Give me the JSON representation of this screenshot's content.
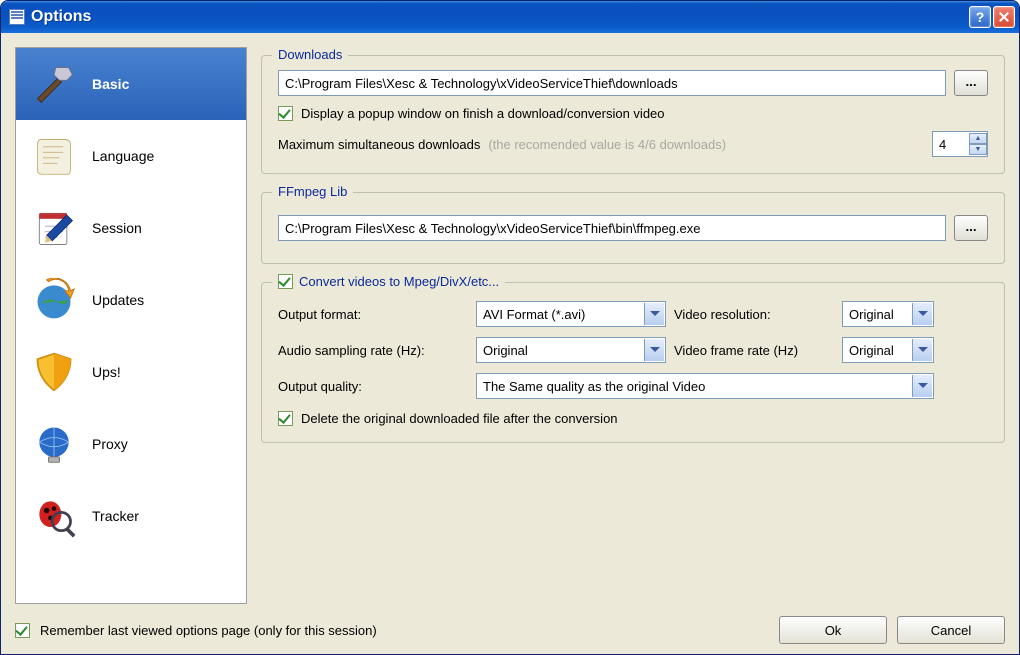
{
  "window": {
    "title": "Options"
  },
  "sidebar": {
    "items": [
      {
        "label": "Basic"
      },
      {
        "label": "Language"
      },
      {
        "label": "Session"
      },
      {
        "label": "Updates"
      },
      {
        "label": "Ups!"
      },
      {
        "label": "Proxy"
      },
      {
        "label": "Tracker"
      }
    ]
  },
  "downloads": {
    "title": "Downloads",
    "path": "C:\\Program Files\\Xesc & Technology\\xVideoServiceThief\\downloads",
    "browse": "...",
    "popup_label": "Display a popup window on finish a download/conversion video",
    "popup_checked": true,
    "max_label": "Maximum simultaneous downloads",
    "max_hint": "(the recomended value is 4/6 downloads)",
    "max_value": "4"
  },
  "ffmpeg": {
    "title": "FFmpeg Lib",
    "path": "C:\\Program Files\\Xesc & Technology\\xVideoServiceThief\\bin\\ffmpeg.exe",
    "browse": "..."
  },
  "convert": {
    "title": "Convert videos to Mpeg/DivX/etc...",
    "checked": true,
    "output_format_label": "Output format:",
    "output_format_value": "AVI Format (*.avi)",
    "video_resolution_label": "Video resolution:",
    "video_resolution_value": "Original",
    "audio_rate_label": "Audio sampling rate (Hz):",
    "audio_rate_value": "Original",
    "video_frame_rate_label": "Video frame rate (Hz)",
    "video_frame_rate_value": "Original",
    "output_quality_label": "Output quality:",
    "output_quality_value": "The Same quality as the original Video",
    "delete_original_label": "Delete the original downloaded file after the conversion",
    "delete_original_checked": true
  },
  "footer": {
    "remember_label": "Remember last viewed options page (only for this session)",
    "remember_checked": true,
    "ok": "Ok",
    "cancel": "Cancel"
  }
}
